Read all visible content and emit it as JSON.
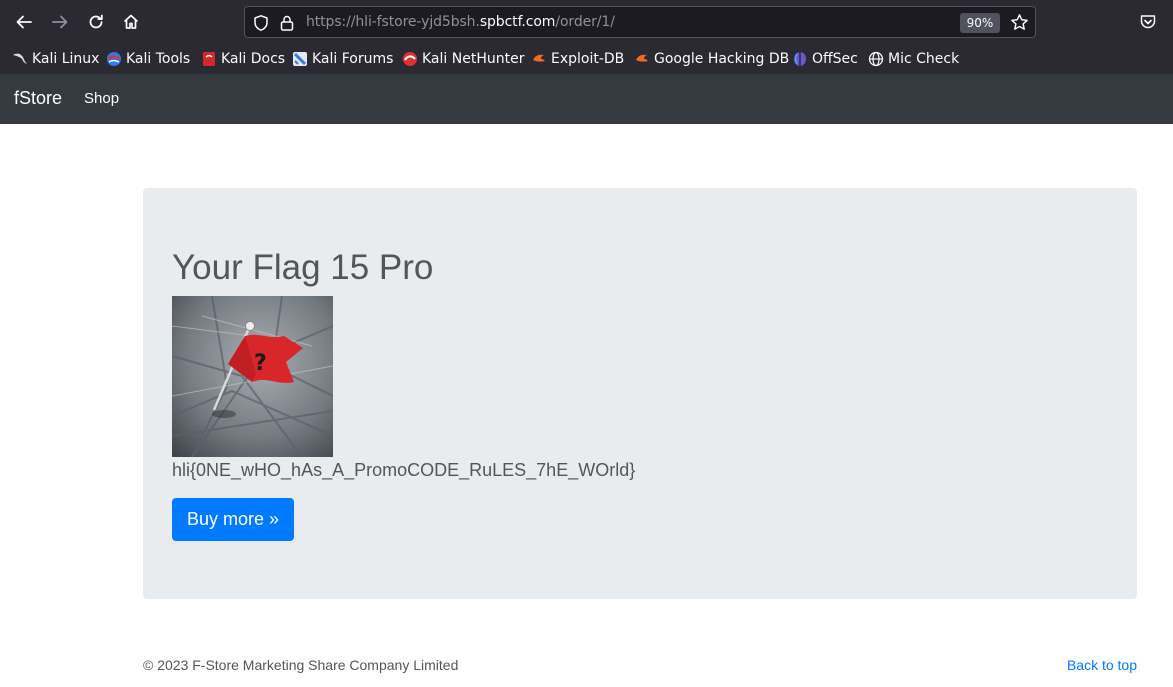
{
  "browser": {
    "url_prefix": "https://hli-fstore-yjd5bsh.",
    "url_host": "spbctf.com",
    "url_path": "/order/1/",
    "zoom": "90%",
    "icons": [
      "back-arrow-icon",
      "forward-arrow-icon",
      "reload-icon",
      "home-icon",
      "shield-icon",
      "lock-icon",
      "star-icon",
      "pocket-icon"
    ],
    "bookmarks": [
      {
        "label": "Kali Linux",
        "icon": "kali-dragon-icon"
      },
      {
        "label": "Kali Tools",
        "icon": "kali-tools-icon"
      },
      {
        "label": "Kali Docs",
        "icon": "kali-docs-icon"
      },
      {
        "label": "Kali Forums",
        "icon": "kali-forums-icon"
      },
      {
        "label": "Kali NetHunter",
        "icon": "nethunter-icon"
      },
      {
        "label": "Exploit-DB",
        "icon": "exploit-db-icon"
      },
      {
        "label": "Google Hacking DB",
        "icon": "ghdb-icon"
      },
      {
        "label": "OffSec",
        "icon": "offsec-icon"
      },
      {
        "label": "Mic Check",
        "icon": "globe-icon"
      }
    ]
  },
  "site": {
    "brand": "fStore",
    "nav_shop": "Shop",
    "colors": {
      "navbar": "#343a40",
      "jumbotron": "#e9ecef",
      "primary": "#007bff"
    }
  },
  "product": {
    "title": "Your Flag 15 Pro",
    "image_icon": "red-flag-question-icon",
    "flag": "hli{0NE_wHO_hAs_A_PromoCODE_RuLES_7hE_WOrld}",
    "buy_label": "Buy more »"
  },
  "footer": {
    "copyright": "© 2023 F-Store Marketing Share Company Limited",
    "back_to_top": "Back to top"
  }
}
